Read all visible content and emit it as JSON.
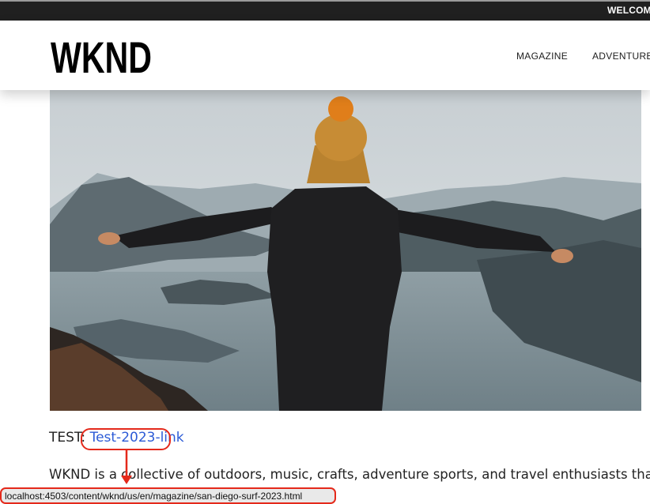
{
  "topbar": {
    "welcome": "WELCOME"
  },
  "header": {
    "logo_text": "WKND",
    "nav": [
      {
        "label": "MAGAZINE"
      },
      {
        "label": "ADVENTURES"
      }
    ]
  },
  "hero": {
    "alt": "Person with outstretched arms and a yellow beanie overlooking mountains and a lake"
  },
  "content": {
    "test_prefix": "TEST:",
    "test_link": "Test-2023-link",
    "intro": "WKND is a collective of outdoors, music, crafts, adventure sports, and travel enthusiasts that want to"
  },
  "status_bar": {
    "url": "localhost:4503/content/wknd/us/en/magazine/san-diego-surf-2023.html"
  },
  "colors": {
    "link": "#2c5bd6",
    "annotation": "#e4291b",
    "topbar": "#202020"
  }
}
